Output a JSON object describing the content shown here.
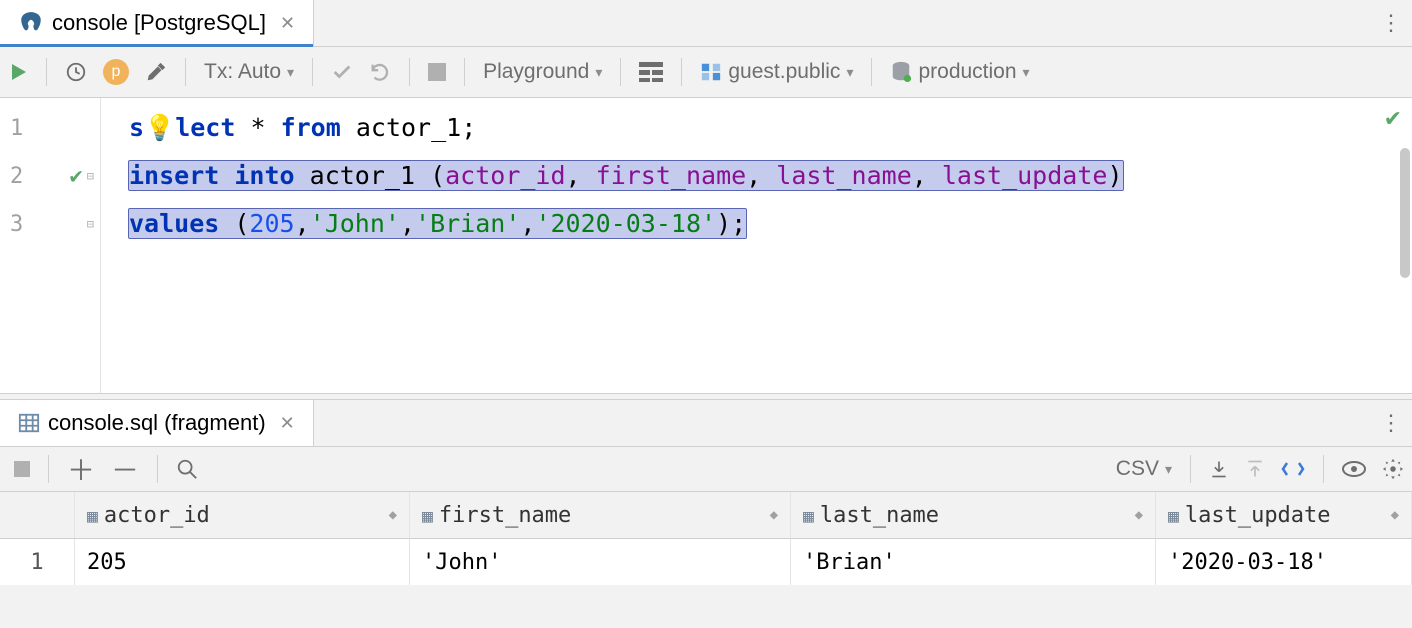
{
  "tabs": {
    "editor_tab_label": "console [PostgreSQL]"
  },
  "toolbar": {
    "tx_label": "Tx: Auto",
    "playground_label": "Playground",
    "schema_label": "guest.public",
    "datasource_label": "production"
  },
  "editor": {
    "gutter": [
      "1",
      "2",
      "3"
    ],
    "line1": {
      "p1_kw": "s",
      "bulb": "💡",
      "p2_kw": "lect",
      "p3": " * ",
      "p4_kw": "from",
      "p5": " actor_1;"
    },
    "line2": {
      "kw1": "insert",
      "sp1": " ",
      "kw2": "into",
      "sp2": " ",
      "tbl": "actor_1 (",
      "c1": "actor_id",
      "com1": ", ",
      "c2": "first_name",
      "com2": ", ",
      "c3": "last_name",
      "com3": ", ",
      "c4": "last_update",
      "end": ")"
    },
    "line3": {
      "kw": "values",
      "open": " (",
      "n": "205",
      "com1": ",",
      "s1": "'John'",
      "com2": ",",
      "s2": "'Brian'",
      "com3": ",",
      "s3": "'2020-03-18'",
      "end": ");"
    }
  },
  "result_tab": {
    "label": "console.sql (fragment)"
  },
  "result_toolbar": {
    "export_label": "CSV"
  },
  "table": {
    "columns": [
      "actor_id",
      "first_name",
      "last_name",
      "last_update"
    ],
    "rows": [
      {
        "n": "1",
        "actor_id": "205",
        "first_name": "'John'",
        "last_name": "'Brian'",
        "last_update": "'2020-03-18'"
      }
    ]
  }
}
